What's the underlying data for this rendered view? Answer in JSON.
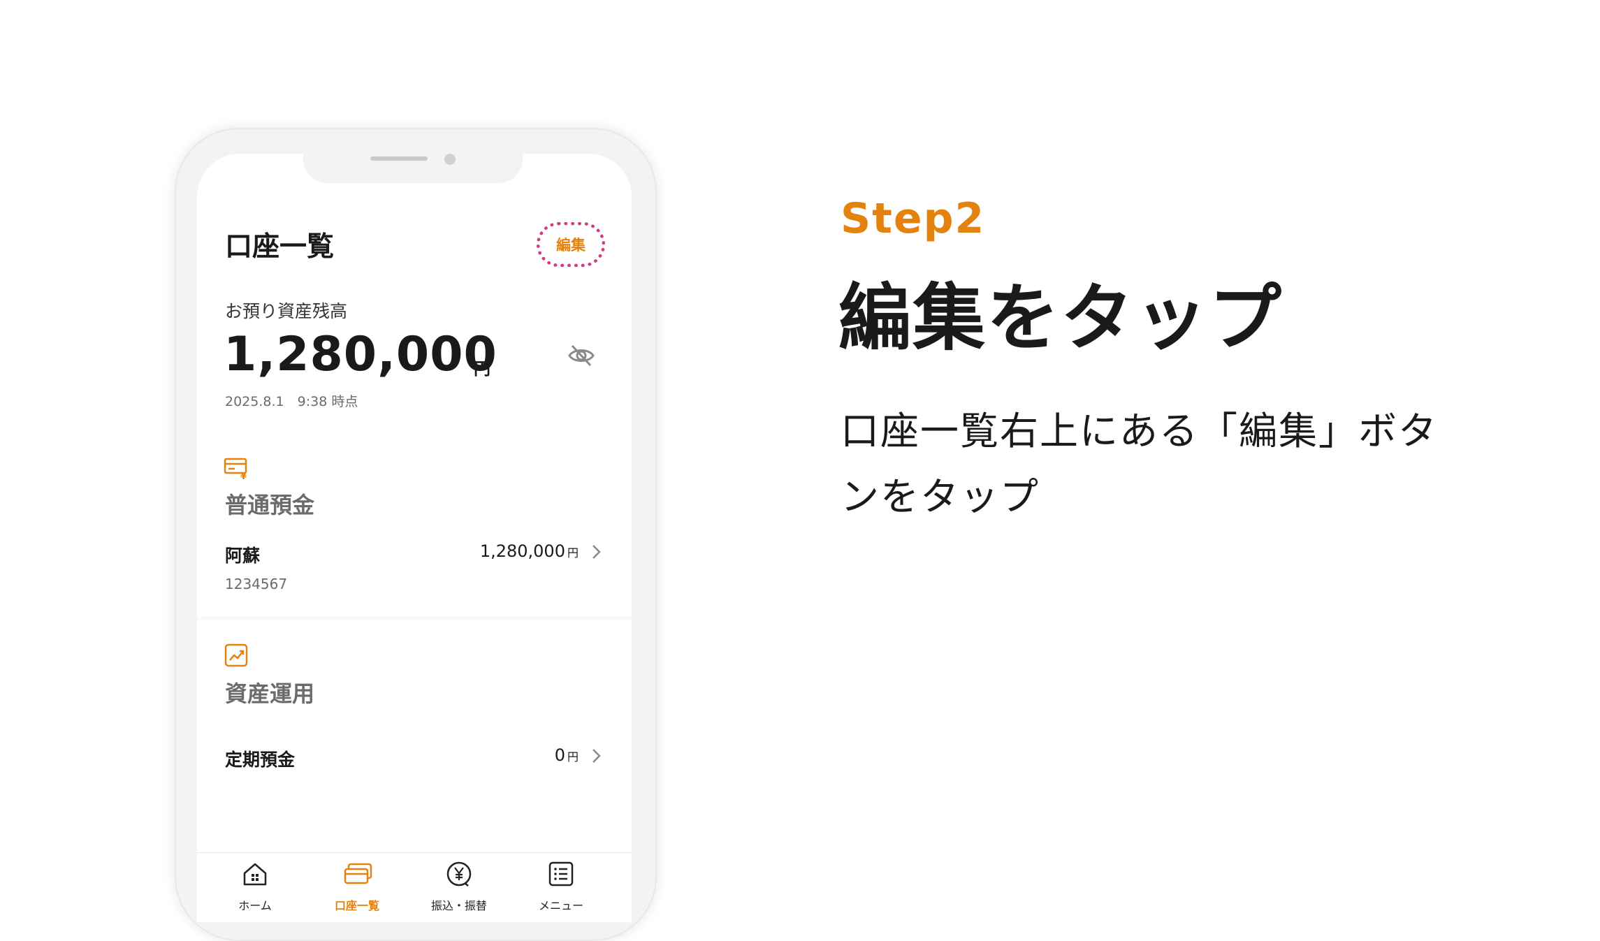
{
  "app": {
    "page_title": "口座一覧",
    "edit_label": "編集",
    "balance": {
      "label": "お預り資産残高",
      "amount": "1,280,000",
      "unit": "円",
      "as_of": "2025.8.1　9:38 時点"
    },
    "sections": [
      {
        "title": "普通預金",
        "icon": "bank-card-yen-icon",
        "rows": [
          {
            "name": "阿蘇",
            "number": "1234567",
            "amount": "1,280,000",
            "unit": "円"
          }
        ]
      },
      {
        "title": "資産運用",
        "icon": "chart-up-icon",
        "rows": [
          {
            "name": "定期預金",
            "amount": "0",
            "unit": "円"
          }
        ]
      }
    ],
    "tabs": [
      {
        "label": "ホーム",
        "icon": "home-icon"
      },
      {
        "label": "口座一覧",
        "icon": "cards-icon",
        "active": true
      },
      {
        "label": "振込・振替",
        "icon": "yen-transfer-icon"
      },
      {
        "label": "メニュー",
        "icon": "list-menu-icon"
      }
    ],
    "accent_color": "#e4820e",
    "highlight_color": "#d23b86"
  },
  "instruction": {
    "step": "Step2",
    "title": "編集をタップ",
    "description": "口座一覧右上にある「編集」ボタンをタップ"
  }
}
